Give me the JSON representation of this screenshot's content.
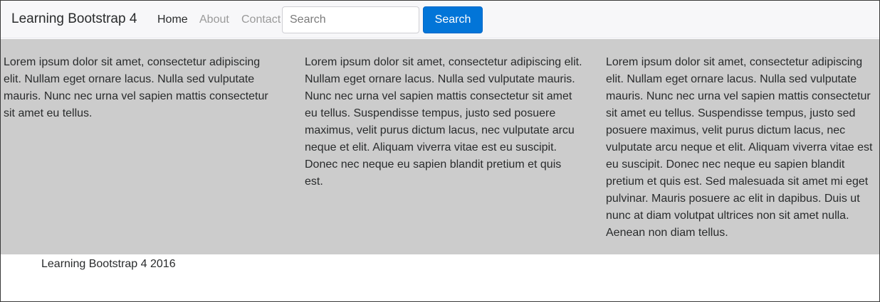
{
  "navbar": {
    "brand": "Learning Bootstrap 4",
    "links": [
      {
        "label": "Home",
        "state": "active"
      },
      {
        "label": "About",
        "state": "muted"
      },
      {
        "label": "Contact",
        "state": "muted"
      }
    ],
    "search": {
      "placeholder": "Search",
      "value": "",
      "button_label": "Search"
    }
  },
  "main": {
    "columns": [
      {
        "text": "Lorem ipsum dolor sit amet, consectetur adipiscing elit. Nullam eget ornare lacus. Nulla sed vulputate mauris. Nunc nec urna vel sapien mattis consectetur sit amet eu tellus."
      },
      {
        "text": "Lorem ipsum dolor sit amet, consectetur adipiscing elit. Nullam eget ornare lacus. Nulla sed vulputate mauris. Nunc nec urna vel sapien mattis consectetur sit amet eu tellus. Suspendisse tempus, justo sed posuere maximus, velit purus dictum lacus, nec vulputate arcu neque et elit. Aliquam viverra vitae est eu suscipit. Donec nec neque eu sapien blandit pretium et quis est."
      },
      {
        "text": "Lorem ipsum dolor sit amet, consectetur adipiscing elit. Nullam eget ornare lacus. Nulla sed vulputate mauris. Nunc nec urna vel sapien mattis consectetur sit amet eu tellus. Suspendisse tempus, justo sed posuere maximus, velit purus dictum lacus, nec vulputate arcu neque et elit. Aliquam viverra vitae est eu suscipit. Donec nec neque eu sapien blandit pretium et quis est. Sed malesuada sit amet mi eget pulvinar. Mauris posuere ac elit in dapibus. Duis ut nunc at diam volutpat ultrices non sit amet nulla. Aenean non diam tellus."
      }
    ]
  },
  "footer": {
    "text": "Learning Bootstrap 4 2016"
  },
  "colors": {
    "navbar_background": "#f7f7f9",
    "content_background": "#cccccc",
    "primary_button": "#0275d8",
    "muted_link": "#9a9a9a",
    "text": "#292b2c"
  }
}
